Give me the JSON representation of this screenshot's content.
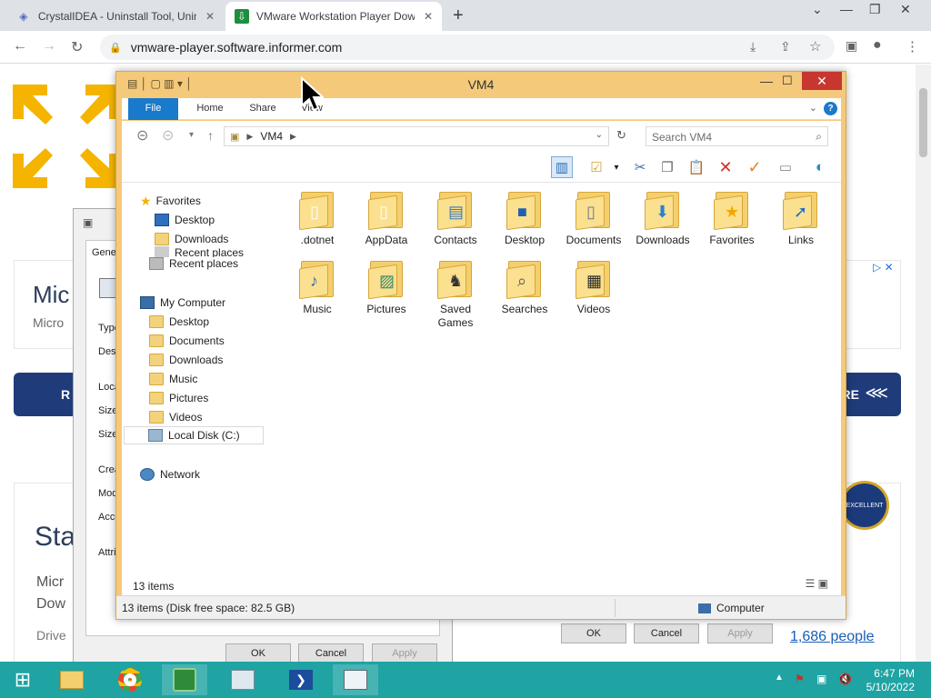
{
  "browser": {
    "tabs": [
      {
        "title": "CrystalIDEA - Uninstall Tool, Unin",
        "active": false
      },
      {
        "title": "VMware Workstation Player Dow",
        "active": true
      }
    ],
    "url": "vmware-player.software.informer.com"
  },
  "webpage": {
    "card1_title": "Mic",
    "card1_sub": "Micro",
    "bar_left": "R",
    "bar_right": "ARE",
    "card2_title": "Sta",
    "card2_line1": "Micr",
    "card2_line2": "Dow",
    "card2_drive": "Drive",
    "badge_text": "EXCELLENT",
    "people_link": "1,686 people"
  },
  "props_dialog": {
    "tab": "Genera",
    "labels": [
      "Type",
      "Desc",
      "Loca",
      "Size:",
      "Size o",
      "Creat",
      "Modif",
      "Acce",
      "Attrib"
    ],
    "buttons": {
      "ok": "OK",
      "cancel": "Cancel",
      "apply": "Apply"
    }
  },
  "explorer": {
    "title": "VM4",
    "ribbon_tabs": [
      "File",
      "Home",
      "Share",
      "View"
    ],
    "address_crumb": "VM4",
    "search_placeholder": "Search VM4",
    "nav": {
      "favorites": "Favorites",
      "fav_items": [
        "Desktop",
        "Downloads",
        "Recent places"
      ],
      "recent_places": "Recent places",
      "my_computer": "My Computer",
      "comp_items": [
        "Desktop",
        "Documents",
        "Downloads",
        "Music",
        "Pictures",
        "Videos"
      ],
      "local_disk": "Local Disk (C:)",
      "network": "Network"
    },
    "files": [
      {
        "name": ".dotnet",
        "icon": "page-icon"
      },
      {
        "name": "AppData",
        "icon": "page-icon"
      },
      {
        "name": "Contacts",
        "icon": "contacts-icon"
      },
      {
        "name": "Desktop",
        "icon": "desktop-icon"
      },
      {
        "name": "Documents",
        "icon": "document-icon"
      },
      {
        "name": "Downloads",
        "icon": "download-arrow-icon"
      },
      {
        "name": "Favorites",
        "icon": "star-icon"
      },
      {
        "name": "Links",
        "icon": "link-arrow-icon"
      },
      {
        "name": "Music",
        "icon": "music-note-icon"
      },
      {
        "name": "Pictures",
        "icon": "picture-icon"
      },
      {
        "name": "Saved Games",
        "icon": "chess-icon"
      },
      {
        "name": "Searches",
        "icon": "magnifier-icon"
      },
      {
        "name": "Videos",
        "icon": "film-icon"
      }
    ],
    "item_count": "13 items",
    "status_left": "13 items (Disk free space: 82.5 GB)",
    "status_right": "Computer",
    "buttons": {
      "ok": "OK",
      "cancel": "Cancel",
      "apply": "Apply"
    }
  },
  "taskbar": {
    "time": "6:47 PM",
    "date": "5/10/2022"
  },
  "colors": {
    "explorer_frame": "#f4c97a",
    "file_tab": "#1979ca",
    "taskbar": "#1fa3a3",
    "close_button": "#c7372f"
  }
}
